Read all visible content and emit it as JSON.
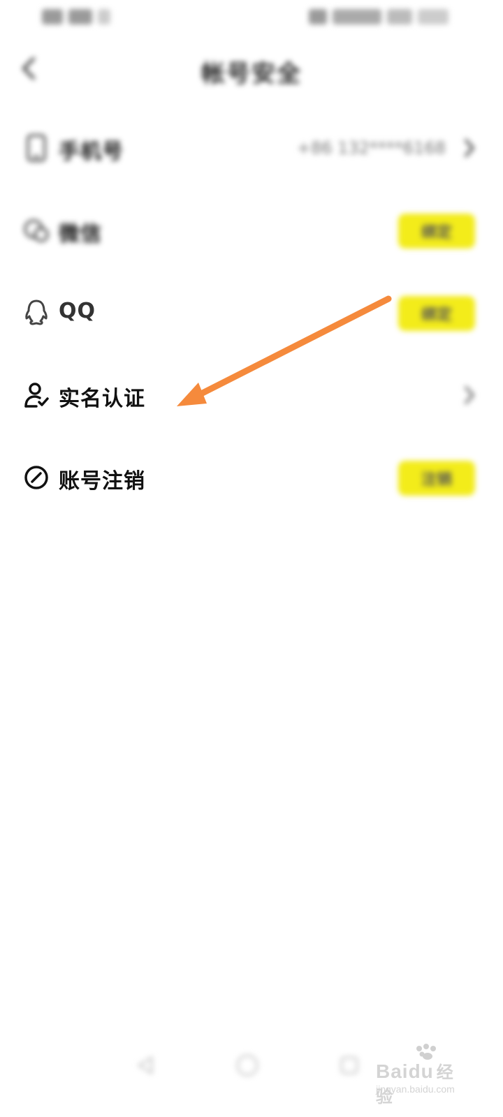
{
  "header": {
    "title": "帐号安全"
  },
  "rows": [
    {
      "label": "手机号",
      "value": "+86 132****6168",
      "control": "chevron",
      "icon": "phone-icon"
    },
    {
      "label": "微信",
      "button": "绑定",
      "control": "button",
      "icon": "wechat-icon"
    },
    {
      "label": "QQ",
      "button": "绑定",
      "control": "button",
      "icon": "qq-icon"
    },
    {
      "label": "实名认证",
      "control": "chevron",
      "icon": "user-verified-icon"
    },
    {
      "label": "账号注销",
      "button": "注销",
      "control": "button",
      "icon": "prohibit-icon"
    }
  ],
  "colors": {
    "accent_button": "#f3ec1a",
    "annotation_arrow": "#f58a3c"
  },
  "watermark": {
    "brand": "Baidu",
    "tagline": "经验",
    "url": "jingyan.baidu.com"
  }
}
